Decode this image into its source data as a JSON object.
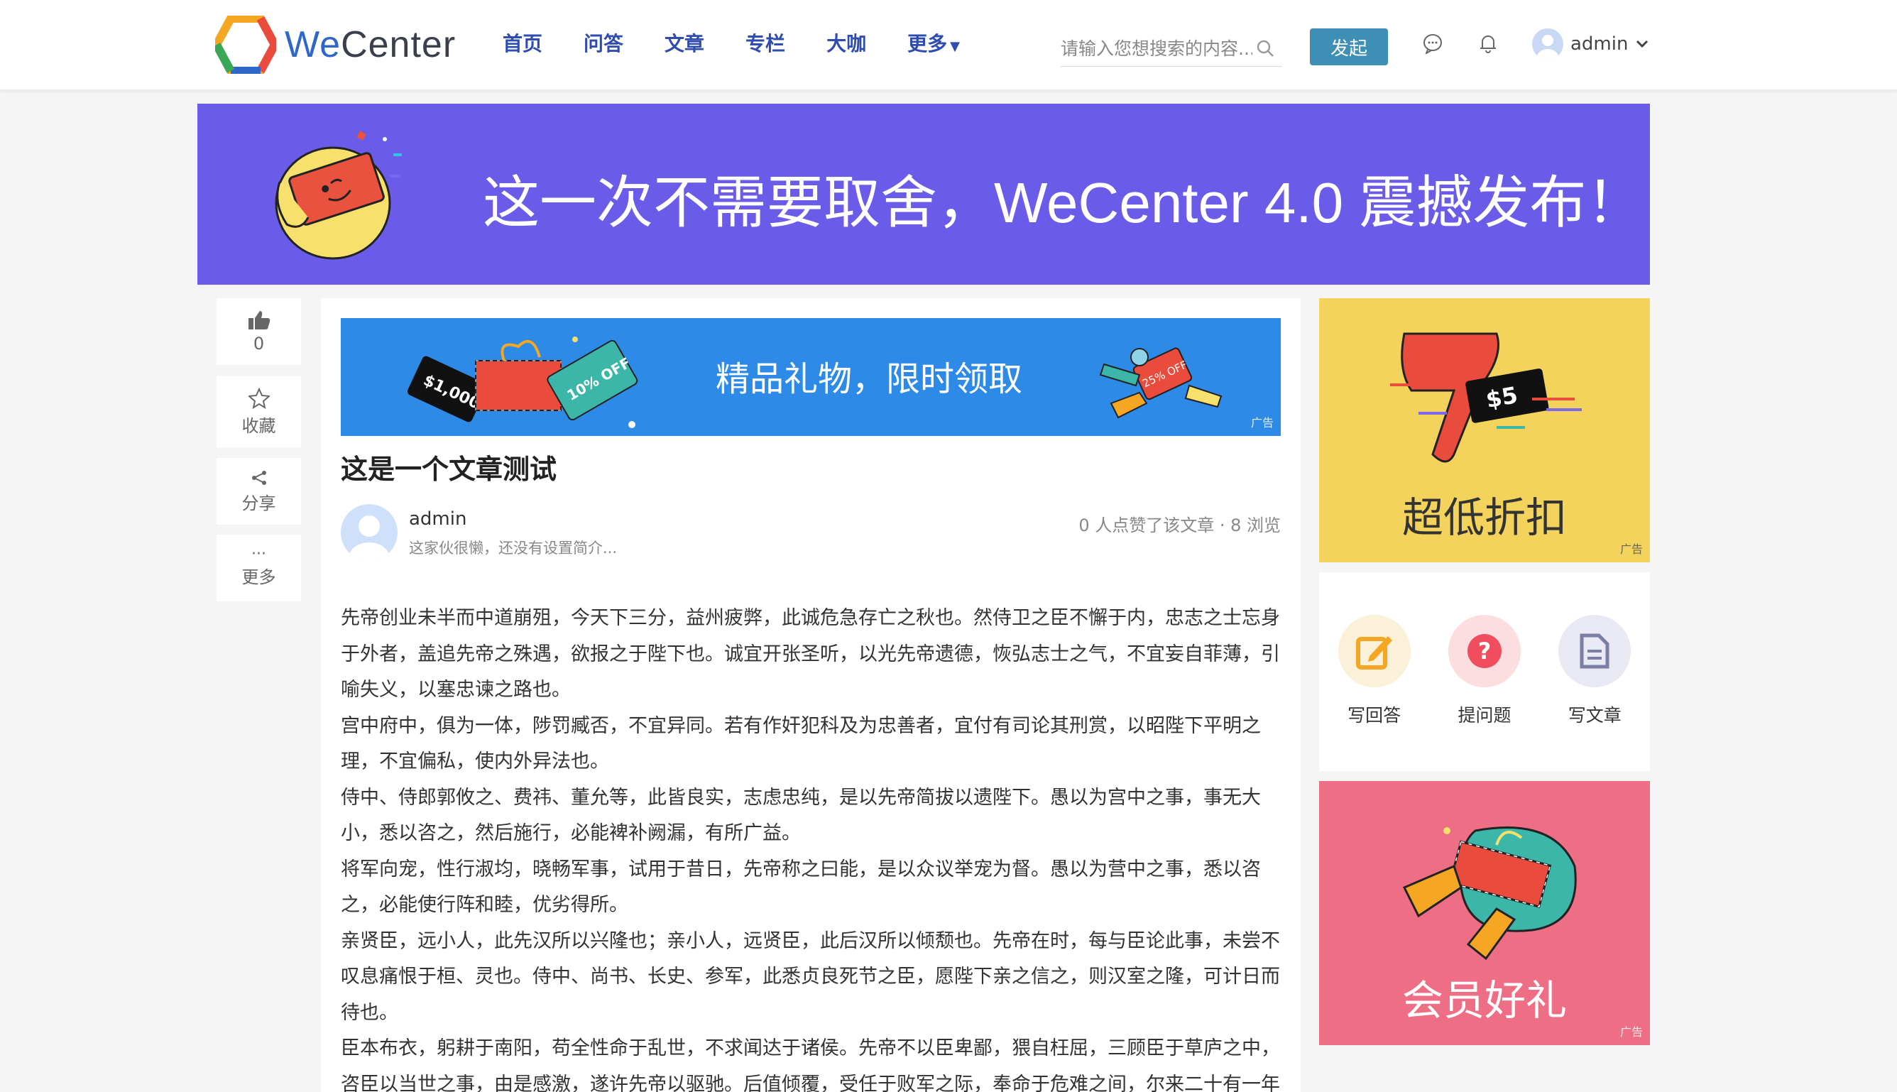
{
  "header": {
    "logo_we": "We",
    "logo_center": "Center",
    "nav": [
      "首页",
      "问答",
      "文章",
      "专栏",
      "大咖",
      "更多"
    ],
    "search_placeholder": "请输入您想搜索的内容...",
    "launch_button": "发起",
    "username": "admin"
  },
  "banner": {
    "text": "这一次不需要取舍，WeCenter 4.0 震撼发布！"
  },
  "side_actions": {
    "like_count": "0",
    "collect": "收藏",
    "share": "分享",
    "more_dots": "···",
    "more": "更多"
  },
  "article": {
    "ad": {
      "text": "精品礼物，限时领取",
      "tag": "广告",
      "coupon_amount": "$1,000",
      "coupon_discount": "10% OFF",
      "small_coupon": "25% OFF"
    },
    "title": "这是一个文章测试",
    "author": {
      "name": "admin",
      "bio": "这家伙很懒，还没有设置简介..."
    },
    "stats": "0 人点赞了该文章 · 8 浏览",
    "paragraphs": [
      "先帝创业未半而中道崩殂，今天下三分，益州疲弊，此诚危急存亡之秋也。然侍卫之臣不懈于内，忠志之士忘身于外者，盖追先帝之殊遇，欲报之于陛下也。诚宜开张圣听，以光先帝遗德，恢弘志士之气，不宜妄自菲薄，引喻失义，以塞忠谏之路也。",
      "宫中府中，俱为一体，陟罚臧否，不宜异同。若有作奸犯科及为忠善者，宜付有司论其刑赏，以昭陛下平明之理，不宜偏私，使内外异法也。",
      "侍中、侍郎郭攸之、费祎、董允等，此皆良实，志虑忠纯，是以先帝简拔以遗陛下。愚以为宫中之事，事无大小，悉以咨之，然后施行，必能裨补阙漏，有所广益。",
      "将军向宠，性行淑均，晓畅军事，试用于昔日，先帝称之曰能，是以众议举宠为督。愚以为营中之事，悉以咨之，必能使行阵和睦，优劣得所。",
      "亲贤臣，远小人，此先汉所以兴隆也；亲小人，远贤臣，此后汉所以倾颓也。先帝在时，每与臣论此事，未尝不叹息痛恨于桓、灵也。侍中、尚书、长史、参军，此悉贞良死节之臣，愿陛下亲之信之，则汉室之隆，可计日而待也。",
      "臣本布衣，躬耕于南阳，苟全性命于乱世，不求闻达于诸侯。先帝不以臣卑鄙，猥自枉屈，三顾臣于草庐之中，咨臣以当世之事，由是感激，遂许先帝以驱驰。后值倾覆，受任于败军之际，奉命于危难之间，尔来二十有一年矣。"
    ]
  },
  "sidebar": {
    "ad_yellow": {
      "text": "超低折扣",
      "tag": "广告",
      "coupon": "$5"
    },
    "quick_actions": [
      {
        "label": "写回答",
        "icon": "edit-icon",
        "color": "#f5a623"
      },
      {
        "label": "提问题",
        "icon": "question-icon",
        "color": "#f04e5e"
      },
      {
        "label": "写文章",
        "icon": "document-icon",
        "color": "#7b7fa6"
      }
    ],
    "ad_pink": {
      "text": "会员好礼",
      "tag": "广告"
    }
  },
  "colors": {
    "nav": "#2f4db0",
    "banner_bg": "#6a5ce8",
    "ad_blue": "#2d8ae7",
    "ad_yellow": "#f3d35b",
    "ad_pink": "#ee6e85",
    "launch_button": "#3e8fb5"
  }
}
